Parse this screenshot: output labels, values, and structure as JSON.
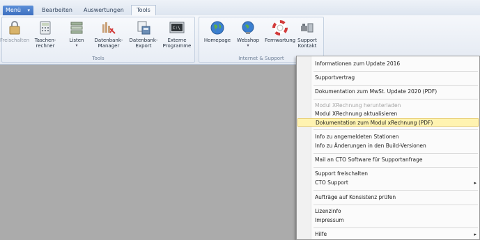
{
  "tabs": {
    "menu": "Menü",
    "bearbeiten": "Bearbeiten",
    "auswertungen": "Auswertungen",
    "tools": "Tools"
  },
  "ribbon": {
    "tools_group": {
      "label": "Tools",
      "buttons": [
        {
          "label1": "Freischalten",
          "label2": "",
          "icon": "lock-icon",
          "disabled": true
        },
        {
          "label1": "Taschen-",
          "label2": "rechner",
          "icon": "calculator-icon"
        },
        {
          "label1": "Listen",
          "label2": "",
          "icon": "list-icon",
          "caret": true
        },
        {
          "label1": "Datenbank-",
          "label2": "Manager",
          "icon": "database-manager-icon"
        },
        {
          "label1": "Datenbank-",
          "label2": "Export",
          "icon": "database-export-icon"
        },
        {
          "label1": "Externe",
          "label2": "Programme",
          "icon": "terminal-icon"
        }
      ]
    },
    "internet_group": {
      "label": "Internet & Support",
      "buttons": [
        {
          "label1": "Homepage",
          "label2": "",
          "icon": "globe-icon"
        },
        {
          "label1": "Webshop",
          "label2": "",
          "icon": "webshop-globe-icon",
          "caret": true
        },
        {
          "label1": "Fernwartung",
          "label2": "",
          "icon": "lifebuoy-icon"
        },
        {
          "label1": "Support",
          "label2": "Kontakt",
          "icon": "support-contact-icon",
          "caret": true
        }
      ]
    }
  },
  "menu": {
    "items": [
      {
        "label": "Informationen zum Update 2016"
      },
      {
        "label": "Supportvertrag"
      },
      {
        "label": "Dokumentation zum MwSt. Update 2020 (PDF)"
      },
      {
        "label": "Modul XRechnung herunterladen",
        "disabled": true
      },
      {
        "label": "Modul XRechnung aktualisieren"
      },
      {
        "label": "Dokumentation zum Modul xRechnung (PDF)",
        "highlighted": true
      },
      {
        "label": "Info zu angemeldeten Stationen"
      },
      {
        "label": "Info zu Änderungen in den Build-Versionen"
      },
      {
        "label": "Mail an CTO Software für Supportanfrage"
      },
      {
        "label": "Support freischalten"
      },
      {
        "label": "CTO Support",
        "submenu": true
      },
      {
        "label": "Aufträge auf Konsistenz prüfen"
      },
      {
        "label": "Lizenzinfo"
      },
      {
        "label": "Impressum"
      },
      {
        "label": "Hilfe",
        "submenu": true
      }
    ],
    "submenu_arrow": "▸"
  },
  "colors": {
    "highlight": "#fff3b0",
    "menu_tab": "#4a7fcf",
    "workspace": "#ababab"
  }
}
